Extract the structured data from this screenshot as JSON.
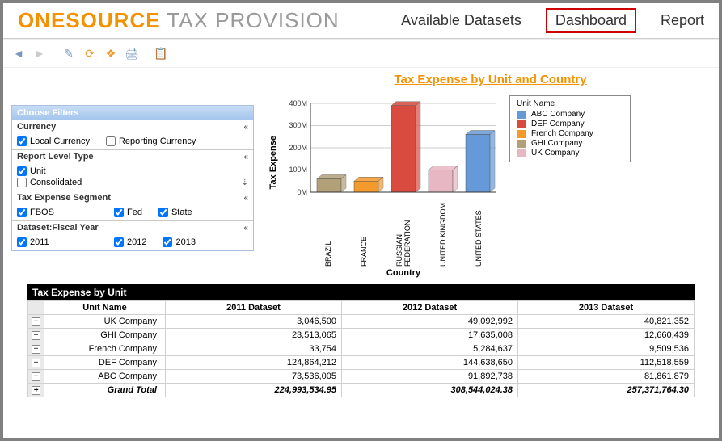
{
  "brand": {
    "part1": "ONESOURCE",
    "part2": " TAX PROVISION"
  },
  "nav": {
    "datasets": "Available Datasets",
    "dashboard": "Dashboard",
    "report": "Report"
  },
  "chart_link": "Tax Expense by Unit and Country",
  "filters": {
    "header": "Choose Filters",
    "currency": {
      "title": "Currency",
      "local": "Local Currency",
      "reporting": "Reporting Currency"
    },
    "report_level": {
      "title": "Report Level Type",
      "unit": "Unit",
      "consolidated": "Consolidated"
    },
    "tax_seg": {
      "title": "Tax Expense Segment",
      "fbos": "FBOS",
      "fed": "Fed",
      "state": "State"
    },
    "fiscal": {
      "title": "Dataset:Fiscal Year",
      "y2011": "2011",
      "y2012": "2012",
      "y2013": "2013"
    }
  },
  "chart_data": {
    "type": "bar",
    "title": "Tax Expense by Unit and Country",
    "xlabel": "Country",
    "ylabel": "Tax Expense",
    "ylim": [
      0,
      400
    ],
    "y_ticks": [
      "0M",
      "100M",
      "200M",
      "300M",
      "400M"
    ],
    "categories": [
      "BRAZIL",
      "FRANCE",
      "RUSSIAN FEDERATION",
      "UNITED KINGDOM",
      "UNITED STATES"
    ],
    "series": [
      {
        "name": "ABC Company",
        "color": "#6699d8"
      },
      {
        "name": "DEF Company",
        "color": "#d94b3f"
      },
      {
        "name": "French Company",
        "color": "#f39a2c"
      },
      {
        "name": "GHI Company",
        "color": "#b2a178"
      },
      {
        "name": "UK Company",
        "color": "#e8b7c4"
      }
    ],
    "bars": [
      {
        "cat": "BRAZIL",
        "series": "GHI Company",
        "value": 60,
        "color": "#b2a178"
      },
      {
        "cat": "FRANCE",
        "series": "French Company",
        "value": 50,
        "color": "#f39a2c"
      },
      {
        "cat": "RUSSIAN FEDERATION",
        "series": "DEF Company",
        "value": 390,
        "color": "#d94b3f"
      },
      {
        "cat": "UNITED KINGDOM",
        "series": "UK Company",
        "value": 100,
        "color": "#e8b7c4"
      },
      {
        "cat": "UNITED STATES",
        "series": "ABC Company",
        "value": 260,
        "color": "#6699d8"
      }
    ],
    "legend_title": "Unit Name"
  },
  "table": {
    "title": "Tax Expense by Unit",
    "headers": [
      "Unit Name",
      "2011 Dataset",
      "2012 Dataset",
      "2013 Dataset"
    ],
    "rows": [
      {
        "name": "UK Company",
        "c1": "3,046,500",
        "c2": "49,092,992",
        "c3": "40,821,352"
      },
      {
        "name": "GHI Company",
        "c1": "23,513,065",
        "c2": "17,635,008",
        "c3": "12,660,439"
      },
      {
        "name": "French Company",
        "c1": "33,754",
        "c2": "5,284,637",
        "c3": "9,509,536"
      },
      {
        "name": "DEF Company",
        "c1": "124,864,212",
        "c2": "144,638,650",
        "c3": "112,518,559"
      },
      {
        "name": "ABC Company",
        "c1": "73,536,005",
        "c2": "91,892,738",
        "c3": "81,861,879"
      }
    ],
    "grand": {
      "label": "Grand Total",
      "c1": "224,993,534.95",
      "c2": "308,544,024.38",
      "c3": "257,371,764.30"
    }
  }
}
